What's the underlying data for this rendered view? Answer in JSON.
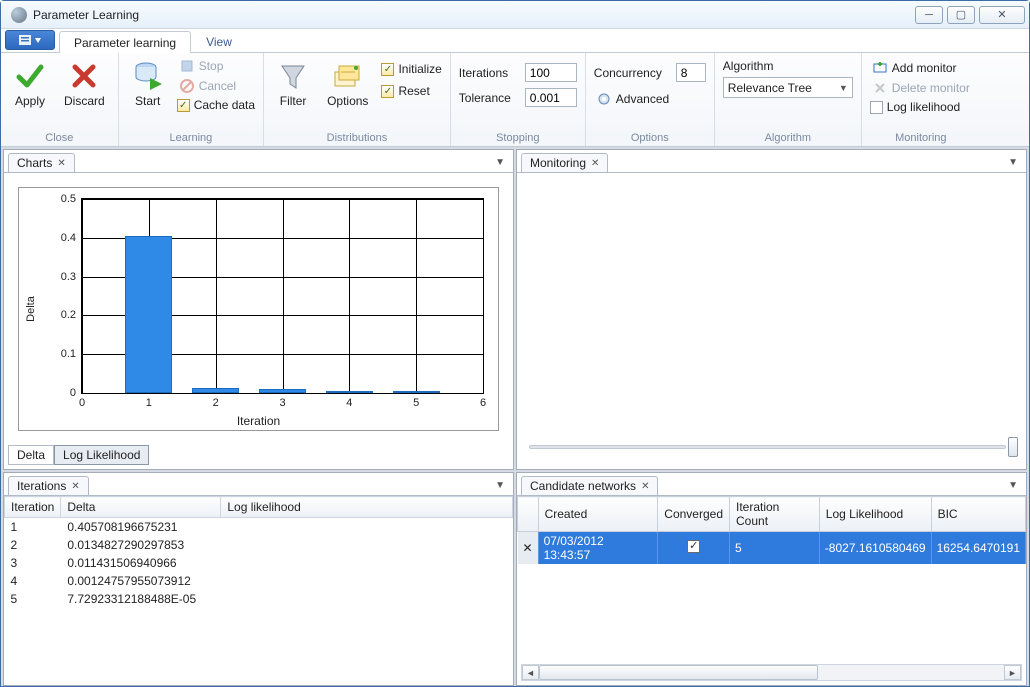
{
  "window": {
    "title": "Parameter Learning"
  },
  "tabs": {
    "active": "Parameter learning",
    "other": "View"
  },
  "ribbon": {
    "close": {
      "label": "Close",
      "apply": "Apply",
      "discard": "Discard"
    },
    "learning": {
      "label": "Learning",
      "start": "Start",
      "stop": "Stop",
      "cancel": "Cancel",
      "cache_data": "Cache data"
    },
    "distributions": {
      "label": "Distributions",
      "filter": "Filter",
      "options": "Options",
      "initialize": "Initialize",
      "reset": "Reset"
    },
    "stopping": {
      "label": "Stopping",
      "iterations_label": "Iterations",
      "iterations_value": "100",
      "tolerance_label": "Tolerance",
      "tolerance_value": "0.001"
    },
    "options": {
      "label": "Options",
      "concurrency_label": "Concurrency",
      "concurrency_value": "8",
      "advanced": "Advanced"
    },
    "algorithm": {
      "label": "Algorithm",
      "heading": "Algorithm",
      "selected": "Relevance Tree"
    },
    "monitoring": {
      "label": "Monitoring",
      "add": "Add monitor",
      "delete": "Delete monitor",
      "loglik": "Log likelihood"
    }
  },
  "panels": {
    "charts": {
      "tab": "Charts",
      "sub_delta": "Delta",
      "sub_loglik": "Log Likelihood"
    },
    "monitoring": {
      "tab": "Monitoring"
    },
    "iterations": {
      "tab": "Iterations",
      "col_iter": "Iteration",
      "col_delta": "Delta",
      "col_loglik": "Log likelihood",
      "rows": [
        {
          "i": "1",
          "d": "0.405708196675231"
        },
        {
          "i": "2",
          "d": "0.0134827290297853"
        },
        {
          "i": "3",
          "d": "0.011431506940966"
        },
        {
          "i": "4",
          "d": "0.00124757955073912"
        },
        {
          "i": "5",
          "d": "7.72923312188488E-05"
        }
      ]
    },
    "candidates": {
      "tab": "Candidate networks",
      "cols": {
        "created": "Created",
        "converged": "Converged",
        "iter": "Iteration Count",
        "loglik": "Log Likelihood",
        "bic": "BIC"
      },
      "row": {
        "created": "07/03/2012 13:43:57",
        "iter": "5",
        "loglik": "-8027.1610580469",
        "bic": "16254.6470191"
      }
    }
  },
  "chart_data": {
    "type": "bar",
    "title": "",
    "xlabel": "Iteration",
    "ylabel": "Delta",
    "categories": [
      "1",
      "2",
      "3",
      "4",
      "5"
    ],
    "values": [
      0.4057,
      0.0135,
      0.0114,
      0.0012,
      0.0001
    ],
    "xlim": [
      0,
      6
    ],
    "ylim": [
      0,
      0.5
    ],
    "yticks": [
      "0",
      "0.1",
      "0.2",
      "0.3",
      "0.4",
      "0.5"
    ],
    "xticks": [
      "0",
      "1",
      "2",
      "3",
      "4",
      "5",
      "6"
    ]
  }
}
